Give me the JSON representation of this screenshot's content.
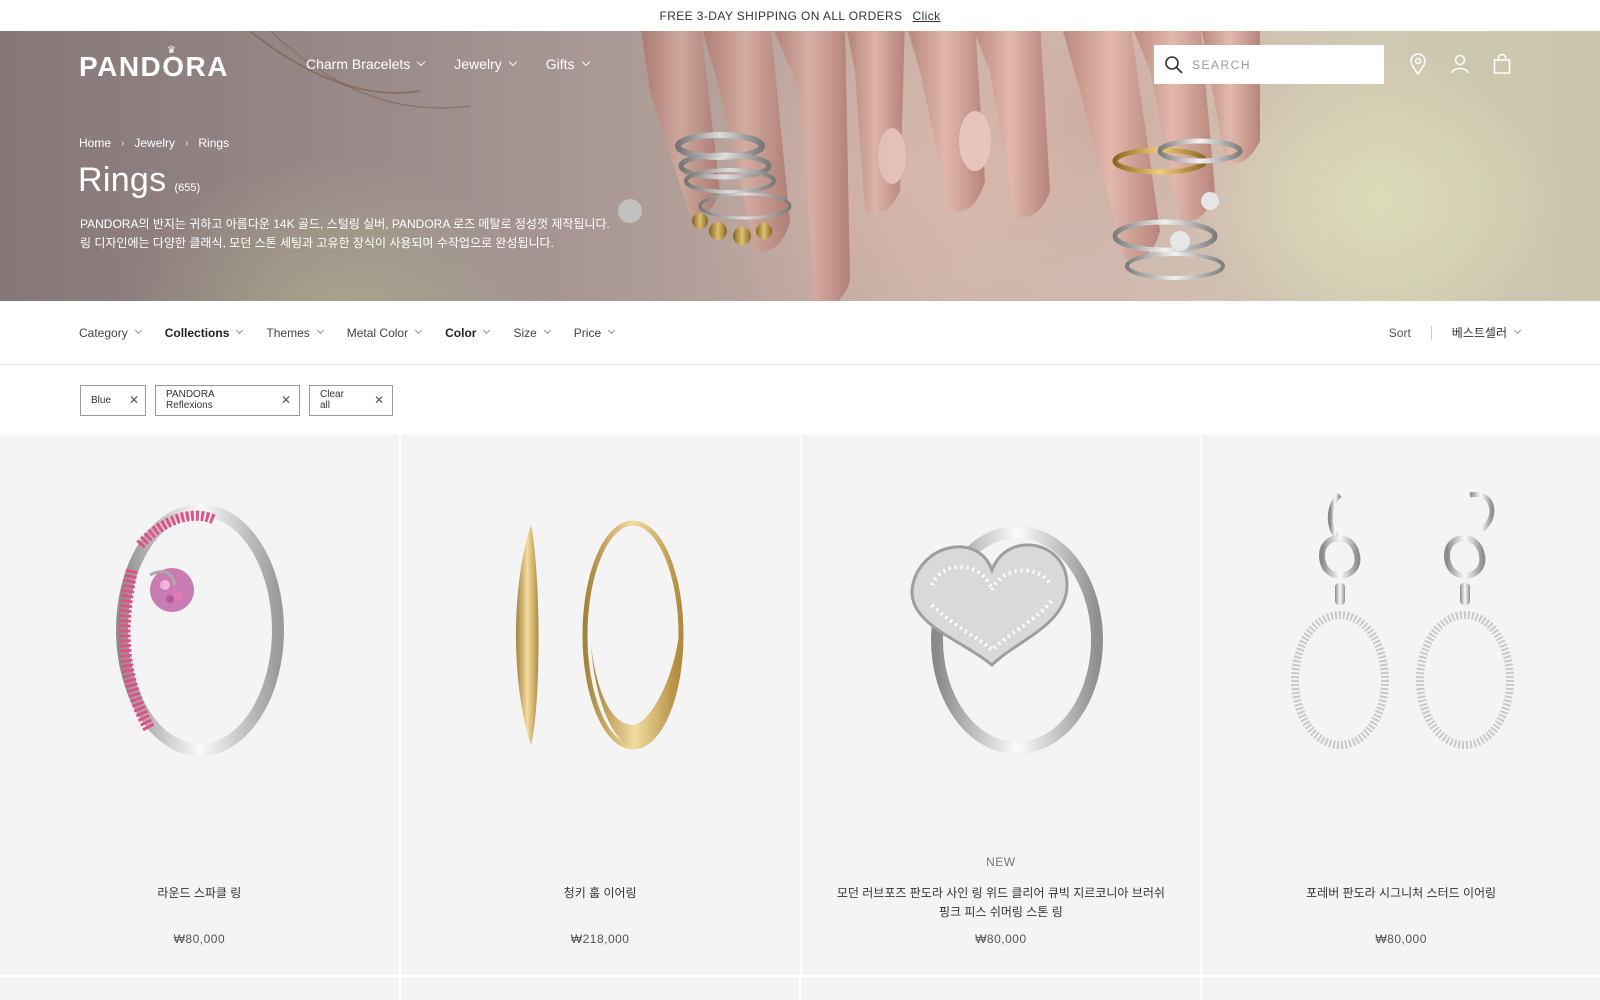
{
  "announcement": {
    "text": "FREE 3-DAY SHIPPING ON ALL ORDERS",
    "link": "Click"
  },
  "header": {
    "logo": "PANDORA",
    "nav": [
      {
        "label": "Charm Bracelets"
      },
      {
        "label": "Jewelry"
      },
      {
        "label": "Gifts"
      }
    ],
    "search_placeholder": "SEARCH",
    "icons": [
      "location-pin-icon",
      "user-icon",
      "shopping-bag-icon"
    ]
  },
  "breadcrumb": [
    "Home",
    "Jewelry",
    "Rings"
  ],
  "page": {
    "title": "Rings",
    "count": "(655)",
    "description_line1": "PANDORA의 반지는 귀하고 아름다운 14K 골드, 스털링 실버, PANDORA 로즈 메탈로 정성껏 제작됩니다.",
    "description_line2": "링 디자인에는 다양한 클래식, 모던 스톤 세팅과 고유한 장식이 사용되며 수작업으로 완성됩니다."
  },
  "filters": [
    {
      "label": "Category",
      "bold": false
    },
    {
      "label": "Collections",
      "bold": true
    },
    {
      "label": "Themes",
      "bold": false
    },
    {
      "label": "Metal Color",
      "bold": false
    },
    {
      "label": "Color",
      "bold": true
    },
    {
      "label": "Size",
      "bold": false
    },
    {
      "label": "Price",
      "bold": false
    }
  ],
  "sort": {
    "label": "Sort",
    "value": "베스트셀러"
  },
  "chips": [
    {
      "label": "Blue",
      "close": "✕"
    },
    {
      "label": "PANDORA Reflexions",
      "close": "✕"
    },
    {
      "label": "Clear all",
      "close": "✕"
    }
  ],
  "products": [
    {
      "tag": "",
      "name": "라운드 스파클 링",
      "price": "₩80,000"
    },
    {
      "tag": "",
      "name": "청키 훕 이어링",
      "price": "₩218,000"
    },
    {
      "tag": "NEW",
      "name": "모던 러브포즈 판도라 사인 링 위드 클리어 큐빅 지르코니아 브러쉬 핑크 피스 쉬머링 스톤 링",
      "price": "₩80,000"
    },
    {
      "tag": "",
      "name": "포레버 판도라 시그니처 스터드 이어링",
      "price": "₩80,000"
    }
  ]
}
